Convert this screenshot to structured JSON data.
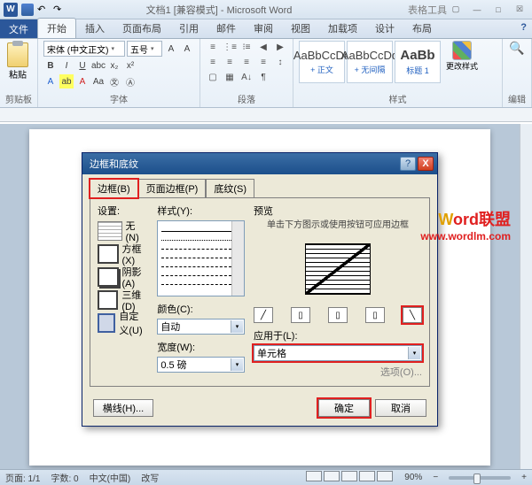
{
  "titlebar": {
    "doc_title": "文档1 [兼容模式] - Microsoft Word",
    "extra": "表格工具"
  },
  "tabs": {
    "file": "文件",
    "home": "开始",
    "insert": "插入",
    "layout": "页面布局",
    "ref": "引用",
    "mail": "邮件",
    "review": "审阅",
    "view": "视图",
    "addin": "加载项",
    "design": "设计",
    "tlayout": "布局"
  },
  "ribbon": {
    "clipboard": {
      "paste": "粘贴",
      "label": "剪贴板"
    },
    "font": {
      "name": "宋体 (中文正文)",
      "size": "五号",
      "label": "字体"
    },
    "paragraph": {
      "label": "段落"
    },
    "styles": {
      "label": "样式",
      "s1": {
        "preview": "AaBbCcDd",
        "name": "+ 正文"
      },
      "s2": {
        "preview": "AaBbCcDd",
        "name": "+ 无间隔"
      },
      "s3": {
        "preview": "AaBb",
        "name": "标题 1"
      },
      "change": "更改样式"
    },
    "editing": {
      "label": "编辑"
    }
  },
  "dialog": {
    "title": "边框和底纹",
    "tabs": {
      "border": "边框(B)",
      "page": "页面边框(P)",
      "shading": "底纹(S)"
    },
    "settings": {
      "hdr": "设置:",
      "none": "无(N)",
      "box": "方框(X)",
      "shadow": "阴影(A)",
      "threed": "三维(D)",
      "custom": "自定义(U)"
    },
    "style": {
      "hdr": "样式(Y):",
      "color": "颜色(C):",
      "color_val": "自动",
      "width": "宽度(W):",
      "width_val": "0.5 磅"
    },
    "preview": {
      "hdr": "预览",
      "hint": "单击下方图示或使用按钮可应用边框",
      "apply": "应用于(L):",
      "apply_val": "单元格",
      "options": "选项(O)..."
    },
    "footer": {
      "hline": "横线(H)...",
      "ok": "确定",
      "cancel": "取消"
    }
  },
  "status": {
    "page": "页面: 1/1",
    "words": "字数: 0",
    "lang": "中文(中国)",
    "mode": "改写",
    "zoom": "90%"
  },
  "watermark": {
    "line1_w": "W",
    "line1_ord": "ord",
    "line1_cn": "联盟",
    "line2": "www.wordlm.com"
  }
}
